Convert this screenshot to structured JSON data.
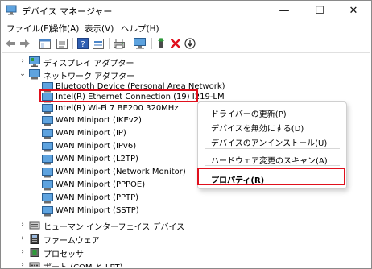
{
  "window": {
    "title": "デバイス マネージャー",
    "minimize": "—",
    "maximize": "☐",
    "close": "✕"
  },
  "menu": [
    "ファイル(F)",
    "操作(A)",
    "表示(V)",
    "ヘルプ(H)"
  ],
  "tree": {
    "display_adapters": "ディスプレイ アダプター",
    "network_adapters": "ネットワーク アダプター",
    "adapters": [
      "Bluetooth Device (Personal Area Network)",
      "Intel(R) Ethernet Connection (19) I219-LM",
      "Intel(R) Wi-Fi 7 BE200 320MHz",
      "WAN Miniport (IKEv2)",
      "WAN Miniport (IP)",
      "WAN Miniport (IPv6)",
      "WAN Miniport (L2TP)",
      "WAN Miniport (Network Monitor)",
      "WAN Miniport (PPPOE)",
      "WAN Miniport (PPTP)",
      "WAN Miniport (SSTP)"
    ],
    "hid": "ヒューマン インターフェイス デバイス",
    "firmware": "ファームウェア",
    "processors": "プロセッサ",
    "ports": "ポート (COM と LPT)"
  },
  "context_menu": {
    "update_driver": "ドライバーの更新(P)",
    "disable_device": "デバイスを無効にする(D)",
    "uninstall_device": "デバイスのアンインストール(U)",
    "scan_hardware": "ハードウェア変更のスキャン(A)",
    "properties": "プロパティ(R)"
  },
  "colors": {
    "highlight": "#e0101d",
    "icon_blue": "#1f6fc1",
    "icon_green": "#2e9a3a"
  }
}
